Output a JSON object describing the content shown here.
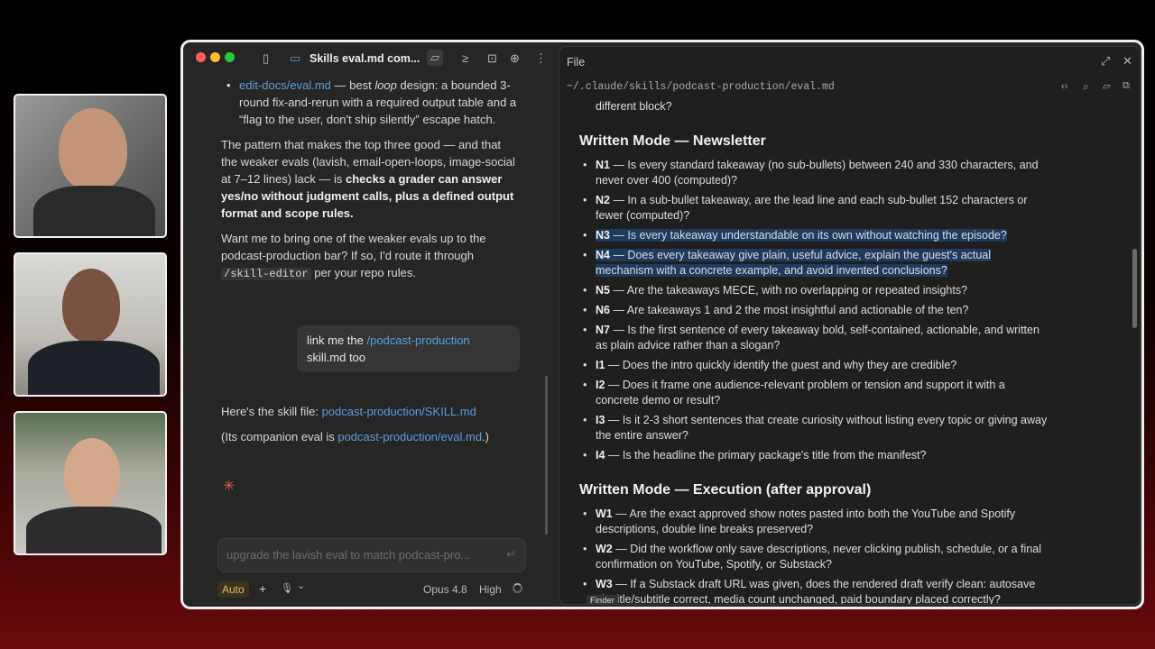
{
  "window": {
    "tab_title": "Skills eval.md com...",
    "traffic": {
      "red": "#ff5f57",
      "yellow": "#febc2e",
      "green": "#28c840"
    }
  },
  "icons": {
    "sidebar": "sidebar-icon",
    "laptop": "laptop-icon",
    "folder": "folder-icon",
    "terminal": "terminal-icon",
    "upload": "upload-icon",
    "globe": "globe-icon",
    "more": "more-icon"
  },
  "chat": {
    "bullet_link": "edit-docs/eval.md",
    "bullet_text_1": " — best ",
    "bullet_loop": "loop",
    "bullet_text_2": " design: a bounded 3-round fix-and-rerun with a required output table and a “flag to the user, don't ship silently” escape hatch.",
    "para1_a": "The pattern that makes the top three good — and that the weaker evals (lavish, email-open-loops, image-social at 7–12 lines) lack — is ",
    "para1_b": "checks a grader can answer yes/no without judgment calls, plus a defined output format and scope rules.",
    "para2_a": "Want me to bring one of the weaker evals up to the podcast-production bar? If so, I'd route it through ",
    "para2_code": "/skill-editor",
    "para2_b": " per your repo rules.",
    "bubble_a": "link me the ",
    "bubble_link": "/podcast-production",
    "bubble_b": "skill.md too",
    "reply_a": "Here's the skill file: ",
    "reply_link": "podcast-production/SKILL.md",
    "reply2_a": "(Its companion eval is ",
    "reply2_link": "podcast-production/eval.md",
    "reply2_b": ".)",
    "spinner": "✳"
  },
  "input": {
    "placeholder": "upgrade the lavish eval to match podcast-pro...",
    "send": "↵"
  },
  "bottom": {
    "mode": "Auto",
    "plus": "+",
    "mic": "🎙",
    "chevron": "⌄",
    "model": "Opus 4.8",
    "effort": "High"
  },
  "file_panel": {
    "title": "File",
    "path": "~/.claude/skills/podcast-production/eval.md",
    "top_cut": "different block?",
    "sections": [
      {
        "heading": "Written Mode — Newsletter",
        "items": [
          {
            "id": "N1",
            "text": " — Is every standard takeaway (no sub-bullets) between 240 and 330 characters, and never over 400 (computed)?",
            "hl": false
          },
          {
            "id": "N2",
            "text": " — In a sub-bullet takeaway, are the lead line and each sub-bullet 152 characters or fewer (computed)?",
            "hl": false
          },
          {
            "id": "N3",
            "text": " — Is every takeaway understandable on its own without watching the episode?",
            "hl": true
          },
          {
            "id": "N4",
            "text": " — Does every takeaway give plain, useful advice, explain the guest's actual mechanism with a concrete example, and avoid invented conclusions?",
            "hl": true
          },
          {
            "id": "N5",
            "text": " — Are the takeaways MECE, with no overlapping or repeated insights?",
            "hl": false
          },
          {
            "id": "N6",
            "text": " — Are takeaways 1 and 2 the most insightful and actionable of the ten?",
            "hl": false
          },
          {
            "id": "N7",
            "text": " — Is the first sentence of every takeaway bold, self-contained, actionable, and written as plain advice rather than a slogan?",
            "hl": false
          },
          {
            "id": "I1",
            "text": " — Does the intro quickly identify the guest and why they are credible?",
            "hl": false
          },
          {
            "id": "I2",
            "text": " — Does it frame one audience-relevant problem or tension and support it with a concrete demo or result?",
            "hl": false
          },
          {
            "id": "I3",
            "text": " — Is it 2-3 short sentences that create curiosity without listing every topic or giving away the entire answer?",
            "hl": false
          },
          {
            "id": "I4",
            "text": " — Is the headline the primary package's title from the manifest?",
            "hl": false
          }
        ]
      },
      {
        "heading": "Written Mode — Execution (after approval)",
        "items": [
          {
            "id": "W1",
            "text": " — Are the exact approved show notes pasted into both the YouTube and Spotify descriptions, double line breaks preserved?",
            "hl": false
          },
          {
            "id": "W2",
            "text": " — Did the workflow only save descriptions, never clicking publish, schedule, or a final confirmation on YouTube, Spotify, or Substack?",
            "hl": false
          },
          {
            "id": "W3",
            "text": " — If a Substack draft URL was given, does the rendered draft verify clean: autosave ok, title/subtitle correct, media count unchanged, paid boundary placed correctly?",
            "hl": false
          }
        ]
      }
    ],
    "finder_label": "Finder"
  }
}
